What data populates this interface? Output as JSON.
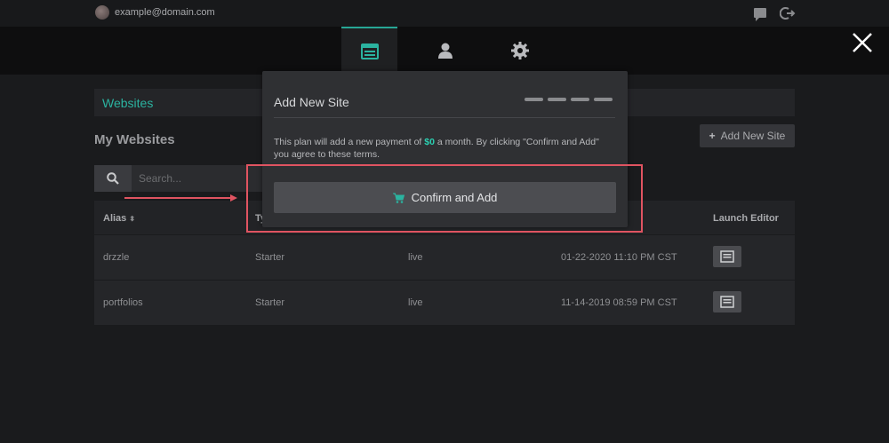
{
  "topbar": {
    "email": "example@domain.com",
    "icons": [
      "avatar",
      "chat-icon",
      "logout-icon"
    ]
  },
  "nav": {
    "tabs": [
      {
        "icon": "websites-icon",
        "active": true
      },
      {
        "icon": "user-icon",
        "active": false
      },
      {
        "icon": "gear-icon",
        "active": false
      }
    ],
    "close_icon": "close-icon"
  },
  "page": {
    "section_label": "Websites",
    "heading": "My Websites",
    "add_site_label": "Add New Site",
    "search_placeholder": "Search..."
  },
  "table": {
    "headers": {
      "alias": "Alias",
      "type_partial": "Ty",
      "launch_editor": "Launch Editor"
    },
    "rows": [
      {
        "alias": "drzzle",
        "type": "Starter",
        "status": "live",
        "date": "01-22-2020 11:10 PM CST"
      },
      {
        "alias": "portfolios",
        "type": "Starter",
        "status": "live",
        "date": "11-14-2019 08:59 PM CST"
      }
    ]
  },
  "modal": {
    "title": "Add New Site",
    "text_before_price": "This plan will add a new payment of ",
    "price": "$0",
    "text_after_price": " a month. By clicking \"Confirm and Add\" you agree to these terms.",
    "confirm_label": "Confirm and Add",
    "steps": 4
  },
  "colors": {
    "accent": "#2bb3a0",
    "price": "#2bd0b2",
    "highlight": "#e05461"
  }
}
